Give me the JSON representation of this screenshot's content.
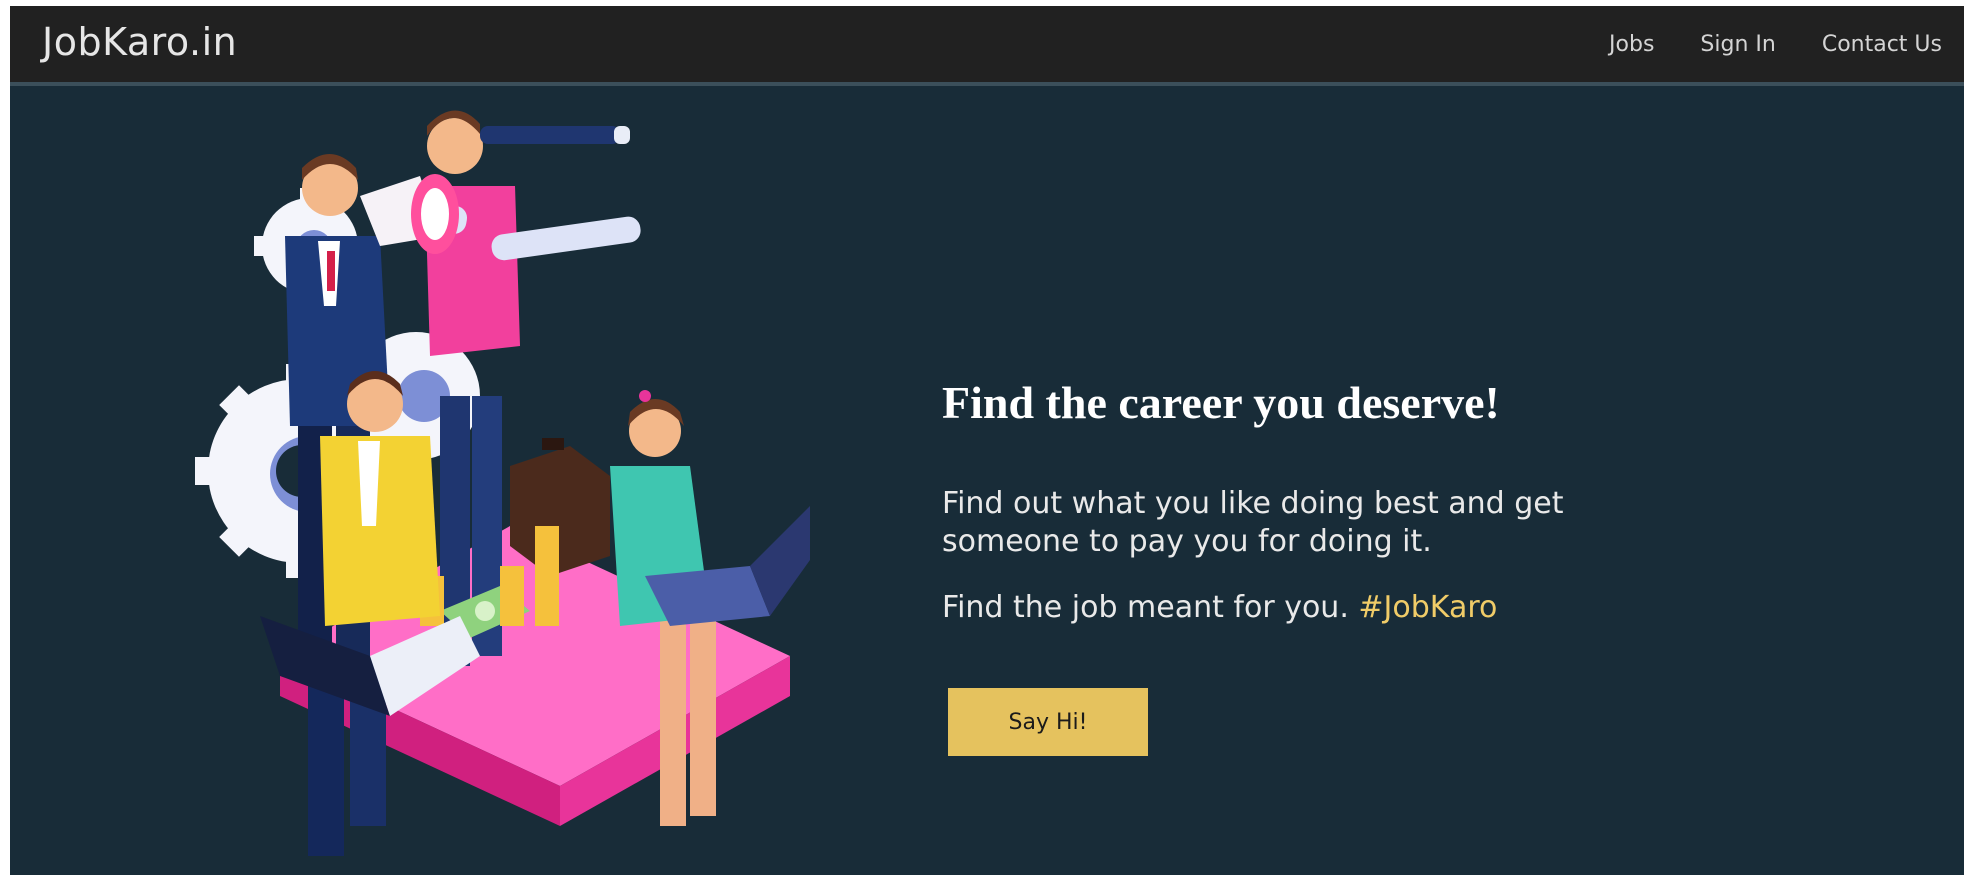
{
  "navbar": {
    "brand": "JobKaro.in",
    "links": [
      {
        "label": "Jobs"
      },
      {
        "label": "Sign In"
      },
      {
        "label": "Contact Us"
      }
    ]
  },
  "hero": {
    "title": "Find the career you deserve!",
    "description": "Find out what you like doing best and get someone to pay you for doing it.",
    "tagline_prefix": "Find the job meant for you.",
    "tagline_hashtag": "#JobKaro",
    "cta_label": "Say Hi!"
  },
  "colors": {
    "navbar_bg": "#212121",
    "page_bg": "#182c38",
    "accent": "#e5c25e",
    "hashtag": "#f0cc68"
  },
  "icons": {
    "illustration": "career-team-illustration"
  }
}
